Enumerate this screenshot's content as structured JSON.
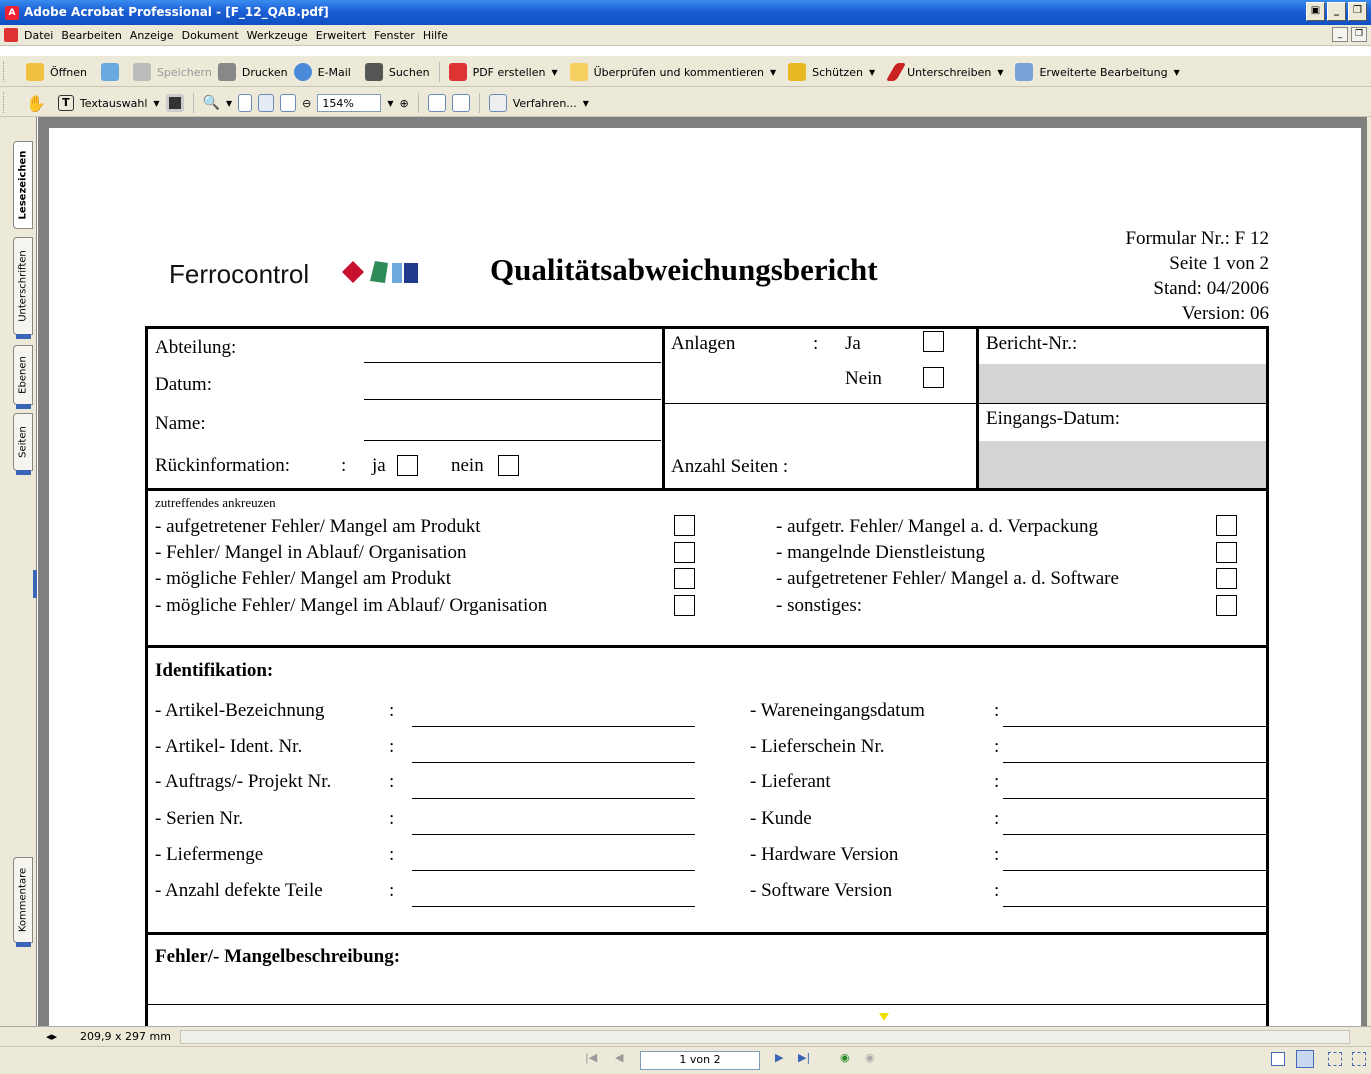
{
  "window": {
    "title": "Adobe Acrobat Professional - [F_12_QAB.pdf]"
  },
  "menu": [
    "Datei",
    "Bearbeiten",
    "Anzeige",
    "Dokument",
    "Werkzeuge",
    "Erweitert",
    "Fenster",
    "Hilfe"
  ],
  "toolbar1": {
    "open": "Öffnen",
    "save": "Speichern",
    "print": "Drucken",
    "email": "E-Mail",
    "search": "Suchen",
    "create_pdf": "PDF erstellen",
    "review": "Überprüfen und kommentieren",
    "secure": "Schützen",
    "sign": "Unterschreiben",
    "advanced": "Erweiterte Bearbeitung"
  },
  "toolbar2": {
    "select_text": "Textauswahl",
    "zoom": "154%",
    "procedures": "Verfahren..."
  },
  "nav_tabs": [
    "Lesezeichen",
    "Unterschriften",
    "Ebenen",
    "Seiten",
    "Kommentare"
  ],
  "doc": {
    "company": "Ferrocontrol",
    "title": "Qualitätsabweichungsbericht",
    "form_no": "Formular Nr.: F 12",
    "page_info": "Seite 1 von 2",
    "stand": "Stand: 04/2006",
    "version": "Version: 06",
    "head": {
      "abteilung": "Abteilung:",
      "datum": "Datum:",
      "name": "Name:",
      "rueck": "Rückinformation:",
      "colon": ":",
      "ja": "ja",
      "nein": "nein",
      "anlagen": "Anlagen",
      "anl_ja": "Ja",
      "anl_nein": "Nein",
      "anzahl_seiten": "Anzahl Seiten  :",
      "bericht_nr": "Bericht-Nr.:",
      "eingangs": "Eingangs-Datum:"
    },
    "check_hint": "zutreffendes ankreuzen",
    "checks_left": [
      "- aufgetretener Fehler/ Mangel am Produkt",
      "- Fehler/ Mangel in Ablauf/ Organisation",
      "- mögliche Fehler/ Mangel am Produkt",
      "- mögliche Fehler/ Mangel im Ablauf/ Organisation"
    ],
    "checks_right": [
      "- aufgetr. Fehler/ Mangel a. d. Verpackung",
      "- mangelnde Dienstleistung",
      "- aufgetretener Fehler/ Mangel a. d. Software",
      "- sonstiges:"
    ],
    "ident_title": "Identifikation:",
    "ident_left": [
      "- Artikel-Bezeichnung",
      "- Artikel- Ident. Nr.",
      "- Auftrags/- Projekt Nr.",
      "- Serien Nr.",
      "- Liefermenge",
      "- Anzahl defekte Teile"
    ],
    "ident_right": [
      "- Wareneingangsdatum",
      "- Lieferschein Nr.",
      "- Lieferant",
      "- Kunde",
      "- Hardware Version",
      "- Software Version"
    ],
    "colon": ":",
    "fehler_title": "Fehler/- Mangelbeschreibung:"
  },
  "status": {
    "page_size": "209,9 x 297 mm",
    "page_nav": "1 von 2"
  }
}
